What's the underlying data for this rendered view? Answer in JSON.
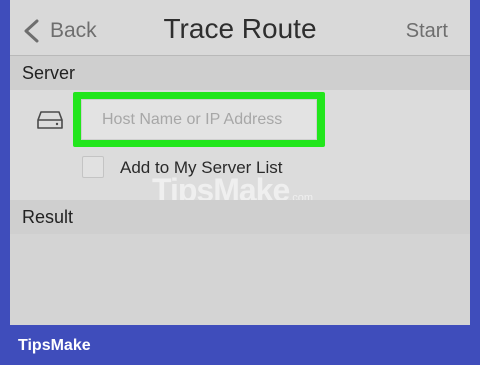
{
  "navbar": {
    "back_label": "Back",
    "title": "Trace Route",
    "start_label": "Start"
  },
  "server": {
    "header": "Server",
    "host_input": {
      "placeholder": "Host Name or IP Address",
      "value": ""
    },
    "add_to_list_label": "Add to My Server List",
    "add_to_list_checked": false
  },
  "result": {
    "header": "Result"
  },
  "watermark": {
    "brand": "TipsMake",
    "suffix": ".com"
  },
  "footer": {
    "brand": "TipsMake"
  },
  "colors": {
    "highlight": "#22e61c",
    "frame": "#3f4dbb",
    "screen_bg": "#d6d6d6"
  },
  "icons": [
    "chevron-left-icon",
    "hard-drive-icon"
  ]
}
